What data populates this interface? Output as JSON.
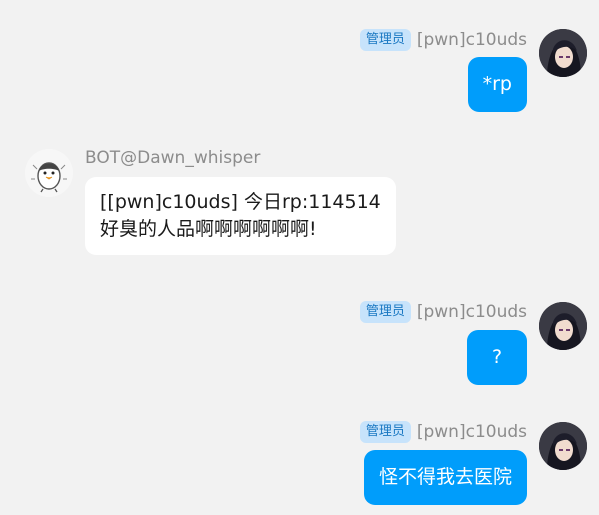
{
  "messages": [
    {
      "sender": "[pwn]c10uds",
      "role": "管理员",
      "text": "*rp"
    },
    {
      "sender": "BOT@Dawn_whisper",
      "lines": [
        "[[pwn]c10uds] 今日rp:114514",
        "好臭的人品啊啊啊啊啊啊!"
      ]
    },
    {
      "sender": "[pwn]c10uds",
      "role": "管理员",
      "text": "?"
    },
    {
      "sender": "[pwn]c10uds",
      "role": "管理员",
      "text": "怪不得我去医院"
    }
  ],
  "colors": {
    "background": "#f2f2f2",
    "self_bubble": "#009dfb",
    "bot_bubble": "#ffffff",
    "role_badge_bg": "#c7e3fb",
    "role_badge_text": "#1a78c2"
  },
  "icons": {
    "user_avatar": "anime-character-avatar",
    "bot_avatar": "penguin-sketch-avatar"
  }
}
